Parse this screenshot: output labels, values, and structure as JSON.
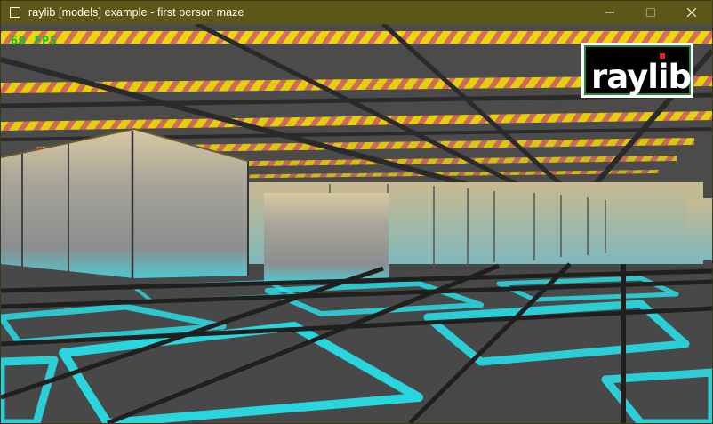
{
  "window": {
    "title": "raylib [models] example - first person maze",
    "minimize_icon": "minimize-icon",
    "maximize_icon": "maximize-icon",
    "close_icon": "close-icon"
  },
  "overlay": {
    "fps_text": "60 FPS",
    "logo_text": "raylib",
    "logo_accent_color": "#e0202a"
  },
  "colors": {
    "titlebar": "#5d5617",
    "fps_text": "#00c21b",
    "ceiling_stripe_yellow": "#ffe600",
    "ceiling_stripe_red": "#e8705a",
    "floor_glow_cyan": "#27e6ee",
    "wall": "#9a9a9a"
  }
}
